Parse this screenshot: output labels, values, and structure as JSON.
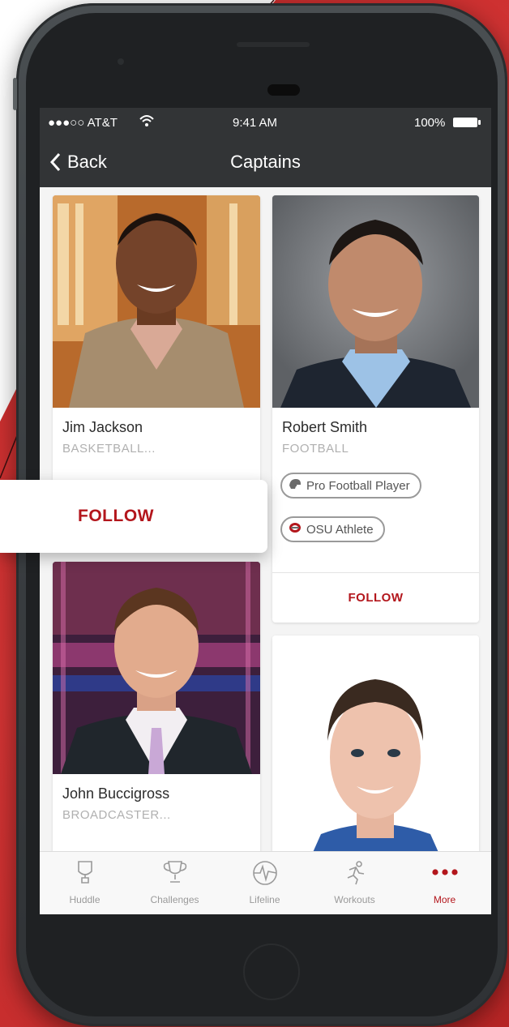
{
  "status_bar": {
    "carrier": "●●●○○ AT&T",
    "time": "9:41 AM",
    "battery": "100%"
  },
  "nav": {
    "back_label": "Back",
    "title": "Captains"
  },
  "cards": [
    {
      "name": "Jim Jackson",
      "sport": "BASKETBALL..."
    },
    {
      "name": "Robert Smith",
      "sport": "FOOTBALL",
      "tags": [
        "Pro Football Player",
        "OSU Athlete"
      ],
      "follow": "FOLLOW"
    },
    {
      "name": "John Buccigross",
      "sport": "BROADCASTER..."
    },
    {
      "name": ""
    }
  ],
  "popout": {
    "follow": "FOLLOW"
  },
  "tab_bar": {
    "tabs": [
      {
        "label": "Huddle",
        "icon": "trophy-cup-icon"
      },
      {
        "label": "Challenges",
        "icon": "trophy-icon"
      },
      {
        "label": "Lifeline",
        "icon": "heartbeat-icon"
      },
      {
        "label": "Workouts",
        "icon": "runner-icon"
      },
      {
        "label": "More",
        "icon": "more-dots-icon"
      }
    ],
    "active": "More"
  },
  "colors": {
    "accent": "#b3161c",
    "nav_bg": "#323436",
    "background_red": "#c42a2a"
  }
}
